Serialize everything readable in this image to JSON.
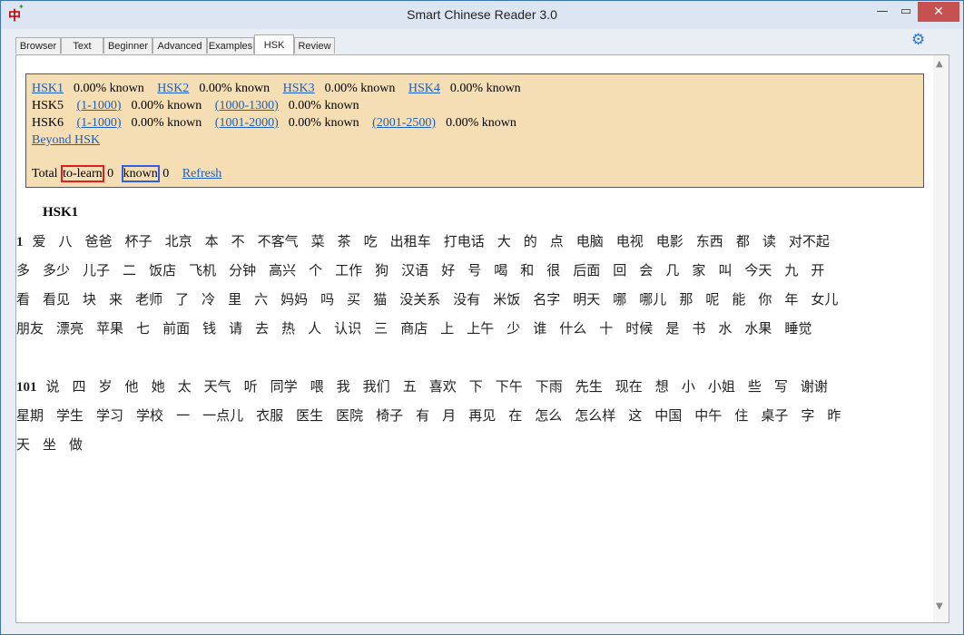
{
  "window": {
    "title": "Smart Chinese Reader 3.0",
    "min": "—",
    "max": "▭",
    "close": "✕"
  },
  "tabs": [
    {
      "label": "Browser"
    },
    {
      "label": "Text"
    },
    {
      "label": "Beginner"
    },
    {
      "label": "Advanced"
    },
    {
      "label": "Examples"
    },
    {
      "label": "HSK"
    },
    {
      "label": "Review"
    }
  ],
  "summary": {
    "row1": [
      {
        "link": "HSK1",
        "pct": "0.00% known"
      },
      {
        "link": "HSK2",
        "pct": "0.00% known"
      },
      {
        "link": "HSK3",
        "pct": "0.00% known"
      },
      {
        "link": "HSK4",
        "pct": "0.00% known"
      }
    ],
    "row2_label": "HSK5",
    "row2": [
      {
        "link": "(1-1000)",
        "pct": "0.00% known"
      },
      {
        "link": "(1000-1300)",
        "pct": "0.00% known"
      }
    ],
    "row3_label": "HSK6",
    "row3": [
      {
        "link": "(1-1000)",
        "pct": "0.00% known"
      },
      {
        "link": "(1001-2000)",
        "pct": "0.00% known"
      },
      {
        "link": "(2001-2500)",
        "pct": "0.00% known"
      }
    ],
    "beyond": "Beyond HSK",
    "total_label": "Total",
    "to_learn_label": "to-learn",
    "to_learn_count": "0",
    "known_label": "known",
    "known_count": "0",
    "refresh": "Refresh"
  },
  "section_title": "HSK1",
  "groups": [
    {
      "number": "1",
      "rows": [
        [
          "爱",
          "八",
          "爸爸",
          "杯子",
          "北京",
          "本",
          "不",
          "不客气",
          "菜",
          "茶",
          "吃",
          "出租车",
          "打电话",
          "大",
          "的",
          "点",
          "电脑",
          "电视",
          "电影",
          "东西",
          "都",
          "读",
          "对不起"
        ],
        [
          "多",
          "多少",
          "儿子",
          "二",
          "饭店",
          "飞机",
          "分钟",
          "高兴",
          "个",
          "工作",
          "狗",
          "汉语",
          "好",
          "号",
          "喝",
          "和",
          "很",
          "后面",
          "回",
          "会",
          "几",
          "家",
          "叫",
          "今天",
          "九",
          "开"
        ],
        [
          "看",
          "看见",
          "块",
          "来",
          "老师",
          "了",
          "冷",
          "里",
          "六",
          "妈妈",
          "吗",
          "买",
          "猫",
          "没关系",
          "没有",
          "米饭",
          "名字",
          "明天",
          "哪",
          "哪儿",
          "那",
          "呢",
          "能",
          "你",
          "年",
          "女儿"
        ],
        [
          "朋友",
          "漂亮",
          "苹果",
          "七",
          "前面",
          "钱",
          "请",
          "去",
          "热",
          "人",
          "认识",
          "三",
          "商店",
          "上",
          "上午",
          "少",
          "谁",
          "什么",
          "十",
          "时候",
          "是",
          "书",
          "水",
          "水果",
          "睡觉"
        ]
      ]
    },
    {
      "number": "101",
      "rows": [
        [
          "说",
          "四",
          "岁",
          "他",
          "她",
          "太",
          "天气",
          "听",
          "同学",
          "喂",
          "我",
          "我们",
          "五",
          "喜欢",
          "下",
          "下午",
          "下雨",
          "先生",
          "现在",
          "想",
          "小",
          "小姐",
          "些",
          "写",
          "谢谢"
        ],
        [
          "星期",
          "学生",
          "学习",
          "学校",
          "一",
          "一点儿",
          "衣服",
          "医生",
          "医院",
          "椅子",
          "有",
          "月",
          "再见",
          "在",
          "怎么",
          "怎么样",
          "这",
          "中国",
          "中午",
          "住",
          "桌子",
          "字",
          "昨"
        ],
        [
          "天",
          "坐",
          "做"
        ]
      ]
    }
  ],
  "icons": {
    "app": "app-logo-icon",
    "settings": "gear-icon"
  },
  "colors": {
    "summary_bg": "#f5deb3",
    "link": "#1f5fb5",
    "to_learn_border": "#e02020",
    "known_border": "#3060e0"
  }
}
